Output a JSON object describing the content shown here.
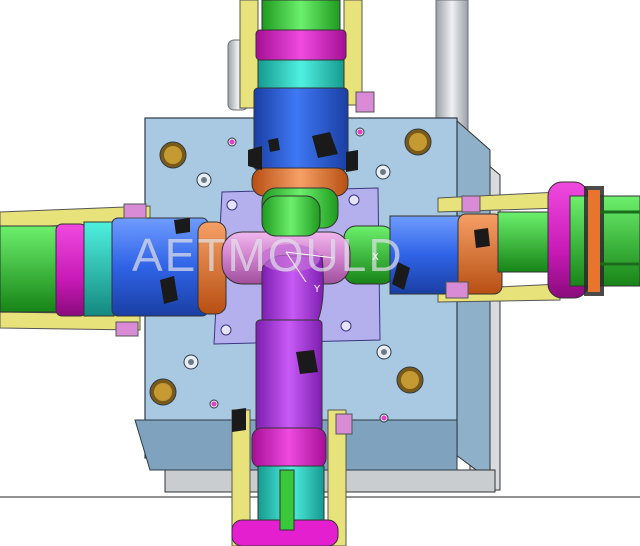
{
  "viewer": {
    "watermark": "AETMOULD",
    "axes": {
      "x": "X",
      "y": "Y"
    }
  },
  "colors": {
    "background": "#ffffff",
    "mold_plate": "#a9c9e3",
    "mold_plate_shadow": "#7fa2be",
    "center_plate": "#b4b0ee",
    "slider_frame": "#e8e27a",
    "core_green": "#3fdc3f",
    "pipe_magenta": "#e31fcf",
    "pipe_teal": "#2fd8c8",
    "pipe_blue": "#2f63e6",
    "pipe_orange": "#e8742e",
    "pipe_purple": "#b83ee8",
    "pipe_pink": "#d98bd6",
    "cylinder_gray": "#cfd3d6"
  },
  "scene_parts": [
    "mold-base-plate",
    "center-insert-plate",
    "top-slider-assembly",
    "bottom-slider-assembly",
    "left-slider-assembly",
    "right-slider-assembly",
    "cross-fitting-part",
    "guide-pillar",
    "hydraulic-cylinder-right"
  ]
}
